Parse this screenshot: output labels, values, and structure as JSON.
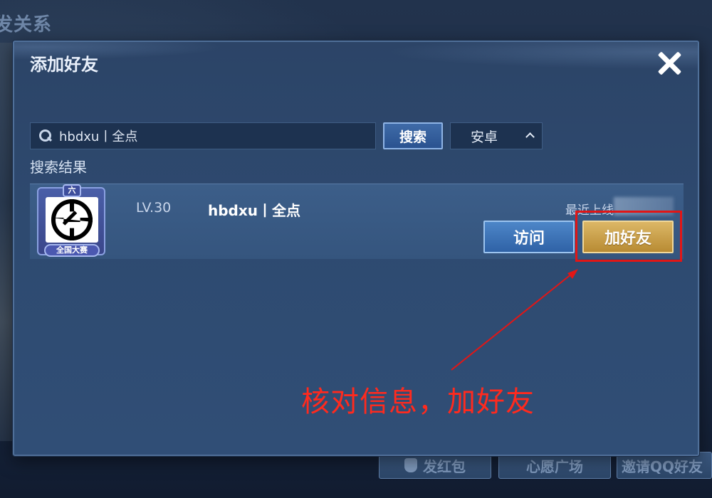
{
  "background": {
    "title_partial": "发关系",
    "bottom_buttons": [
      "发红包",
      "心愿广场",
      "邀请QQ好友"
    ]
  },
  "dialog": {
    "title": "添加好友"
  },
  "search": {
    "query": "hbdxu丨全点",
    "button_label": "搜索",
    "platform": "安卓"
  },
  "results": {
    "label": "搜索结果",
    "items": [
      {
        "level": "LV.30",
        "name": "hbdxu丨全点",
        "last_online": "最近上线",
        "badge_top": "六",
        "badge_bottom": "全国大赛",
        "visit_label": "访问",
        "add_label": "加好友"
      }
    ]
  },
  "annotation": {
    "text": "核对信息，加好友",
    "color": "#ff2a1e"
  }
}
